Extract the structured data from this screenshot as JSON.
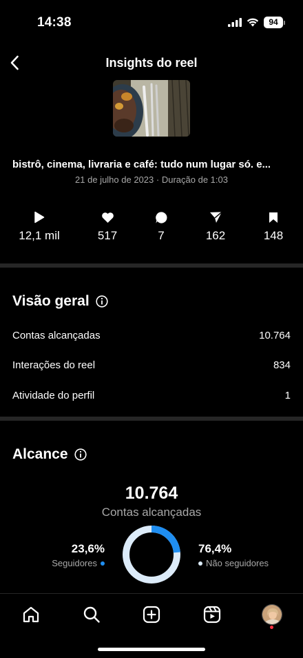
{
  "status_bar": {
    "time": "14:38",
    "battery": "94"
  },
  "header": {
    "title": "Insights do reel"
  },
  "reel": {
    "caption": "bistrô, cinema, livraria e café: tudo num lugar só. e...",
    "date": "21 de julho de 2023",
    "separator": "·",
    "duration": "Duração de 1:03"
  },
  "stats": [
    {
      "icon": "play-icon",
      "value": "12,1 mil"
    },
    {
      "icon": "heart-icon",
      "value": "517"
    },
    {
      "icon": "comment-icon",
      "value": "7"
    },
    {
      "icon": "share-icon",
      "value": "162"
    },
    {
      "icon": "bookmark-icon",
      "value": "148"
    }
  ],
  "overview": {
    "title": "Visão geral",
    "rows": [
      {
        "label": "Contas alcançadas",
        "value": "10.764"
      },
      {
        "label": "Interações do reel",
        "value": "834"
      },
      {
        "label": "Atividade do perfil",
        "value": "1"
      }
    ]
  },
  "reach": {
    "title": "Alcance",
    "total": "10.764",
    "total_label": "Contas alcançadas",
    "followers_pct": "23,6%",
    "followers_label": "Seguidores",
    "followers_fraction": 0.236,
    "non_followers_pct": "76,4%",
    "non_followers_label": "Não seguidores",
    "followers_color": "#1f8ef1",
    "non_followers_color": "#dcebf9"
  },
  "tab_bar": [
    "home-icon",
    "search-icon",
    "create-icon",
    "reels-icon",
    "profile-avatar"
  ],
  "colors": {
    "background": "#000000",
    "muted_text": "#a8a8a8",
    "divider": "#262626",
    "notification": "#ff3040"
  }
}
